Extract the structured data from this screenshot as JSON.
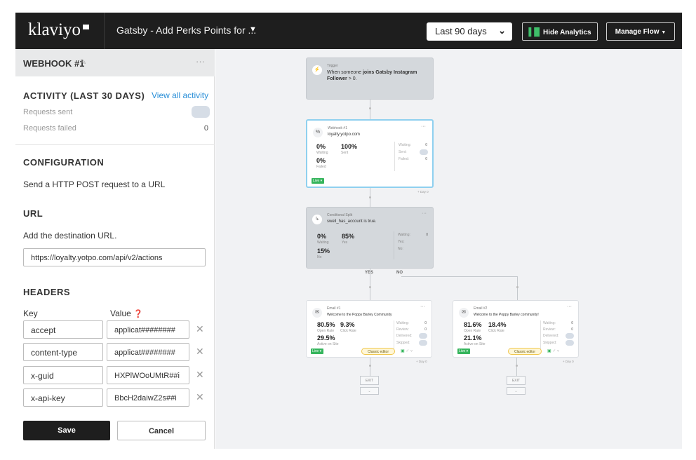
{
  "topbar": {
    "logo": "klaviyo",
    "flow_title": "Gatsby - Add Perks Points for ...",
    "date_range": "Last 90 days",
    "hide_analytics": "Hide Analytics",
    "manage_flow": "Manage Flow"
  },
  "sidebar": {
    "title": "WEBHOOK #1",
    "more": "···",
    "activity": {
      "title": "ACTIVITY (LAST 30 DAYS)",
      "view_all": "View all activity",
      "requests_sent_label": "Requests sent",
      "requests_failed_label": "Requests failed",
      "requests_failed_value": "0"
    },
    "configuration": {
      "title": "CONFIGURATION",
      "description": "Send a HTTP POST request to a URL"
    },
    "url": {
      "title": "URL",
      "description": "Add the destination URL.",
      "value": "https://loyalty.yotpo.com/api/v2/actions"
    },
    "headers": {
      "title": "HEADERS",
      "key_label": "Key",
      "value_label": "Value",
      "rows": [
        {
          "key": "accept",
          "value": "applicat########"
        },
        {
          "key": "content-type",
          "value": "applicat########"
        },
        {
          "key": "x-guid",
          "value": "HXPlWOoUMtR##i"
        },
        {
          "key": "x-api-key",
          "value": "BbcH2daiwZ2s##i"
        }
      ]
    },
    "save": "Save",
    "cancel": "Cancel"
  },
  "canvas": {
    "trigger": {
      "type": "Trigger",
      "desc_pre": "When someone ",
      "desc_bold": "joins Gatsby Instagram Follower",
      "desc_post": " > 0."
    },
    "webhook": {
      "type": "Webhook #1",
      "desc": "loyalty.yotpo.com",
      "waiting_pct": "0%",
      "waiting_label": "Waiting",
      "sent_pct": "100%",
      "sent_label": "Sent",
      "failed_pct": "0%",
      "failed_label": "Failed",
      "side_waiting_label": "Waiting:",
      "side_waiting_value": "0",
      "side_sent_label": "Sent:",
      "side_failed_label": "Failed:",
      "side_failed_value": "0",
      "live": "Live",
      "delay": "+ Day 0"
    },
    "split": {
      "type": "Conditional Split",
      "desc": "swell_has_account is true.",
      "waiting_pct": "0%",
      "waiting_label": "Waiting",
      "yes_pct": "85%",
      "yes_label": "Yes",
      "no_pct": "15%",
      "no_label": "No",
      "side_waiting_label": "Waiting:",
      "side_waiting_value": "0",
      "side_yes_label": "Yes:",
      "side_no_label": "No:",
      "branch_yes": "YES",
      "branch_no": "NO"
    },
    "email1": {
      "type": "Email #1",
      "desc": "Welcome to the Poppy Barley Community",
      "open_rate": "80.5%",
      "open_rate_label": "Open Rate",
      "click_rate": "9.3%",
      "click_rate_label": "Click Rate",
      "active": "29.5%",
      "active_label": "Active on Site",
      "side_waiting_label": "Waiting:",
      "side_waiting_value": "0",
      "side_review_label": "Review:",
      "side_review_value": "0",
      "side_delivered_label": "Delivered:",
      "side_skipped_label": "Skipped:",
      "live": "Live",
      "classic": "Classic editor",
      "delay": "+ Day 0",
      "exit": "EXIT"
    },
    "email2": {
      "type": "Email #2",
      "desc": "Welcome to the Poppy Barley community!",
      "open_rate": "81.6%",
      "open_rate_label": "Open Rate",
      "click_rate": "18.4%",
      "click_rate_label": "Click Rate",
      "active": "21.1%",
      "active_label": "Active on Site",
      "side_waiting_label": "Waiting:",
      "side_waiting_value": "0",
      "side_review_label": "Review:",
      "side_review_value": "0",
      "side_delivered_label": "Delivered:",
      "side_skipped_label": "Skipped:",
      "live": "Live",
      "classic": "Classic editor",
      "delay": "+ Day 0",
      "exit": "EXIT"
    }
  }
}
